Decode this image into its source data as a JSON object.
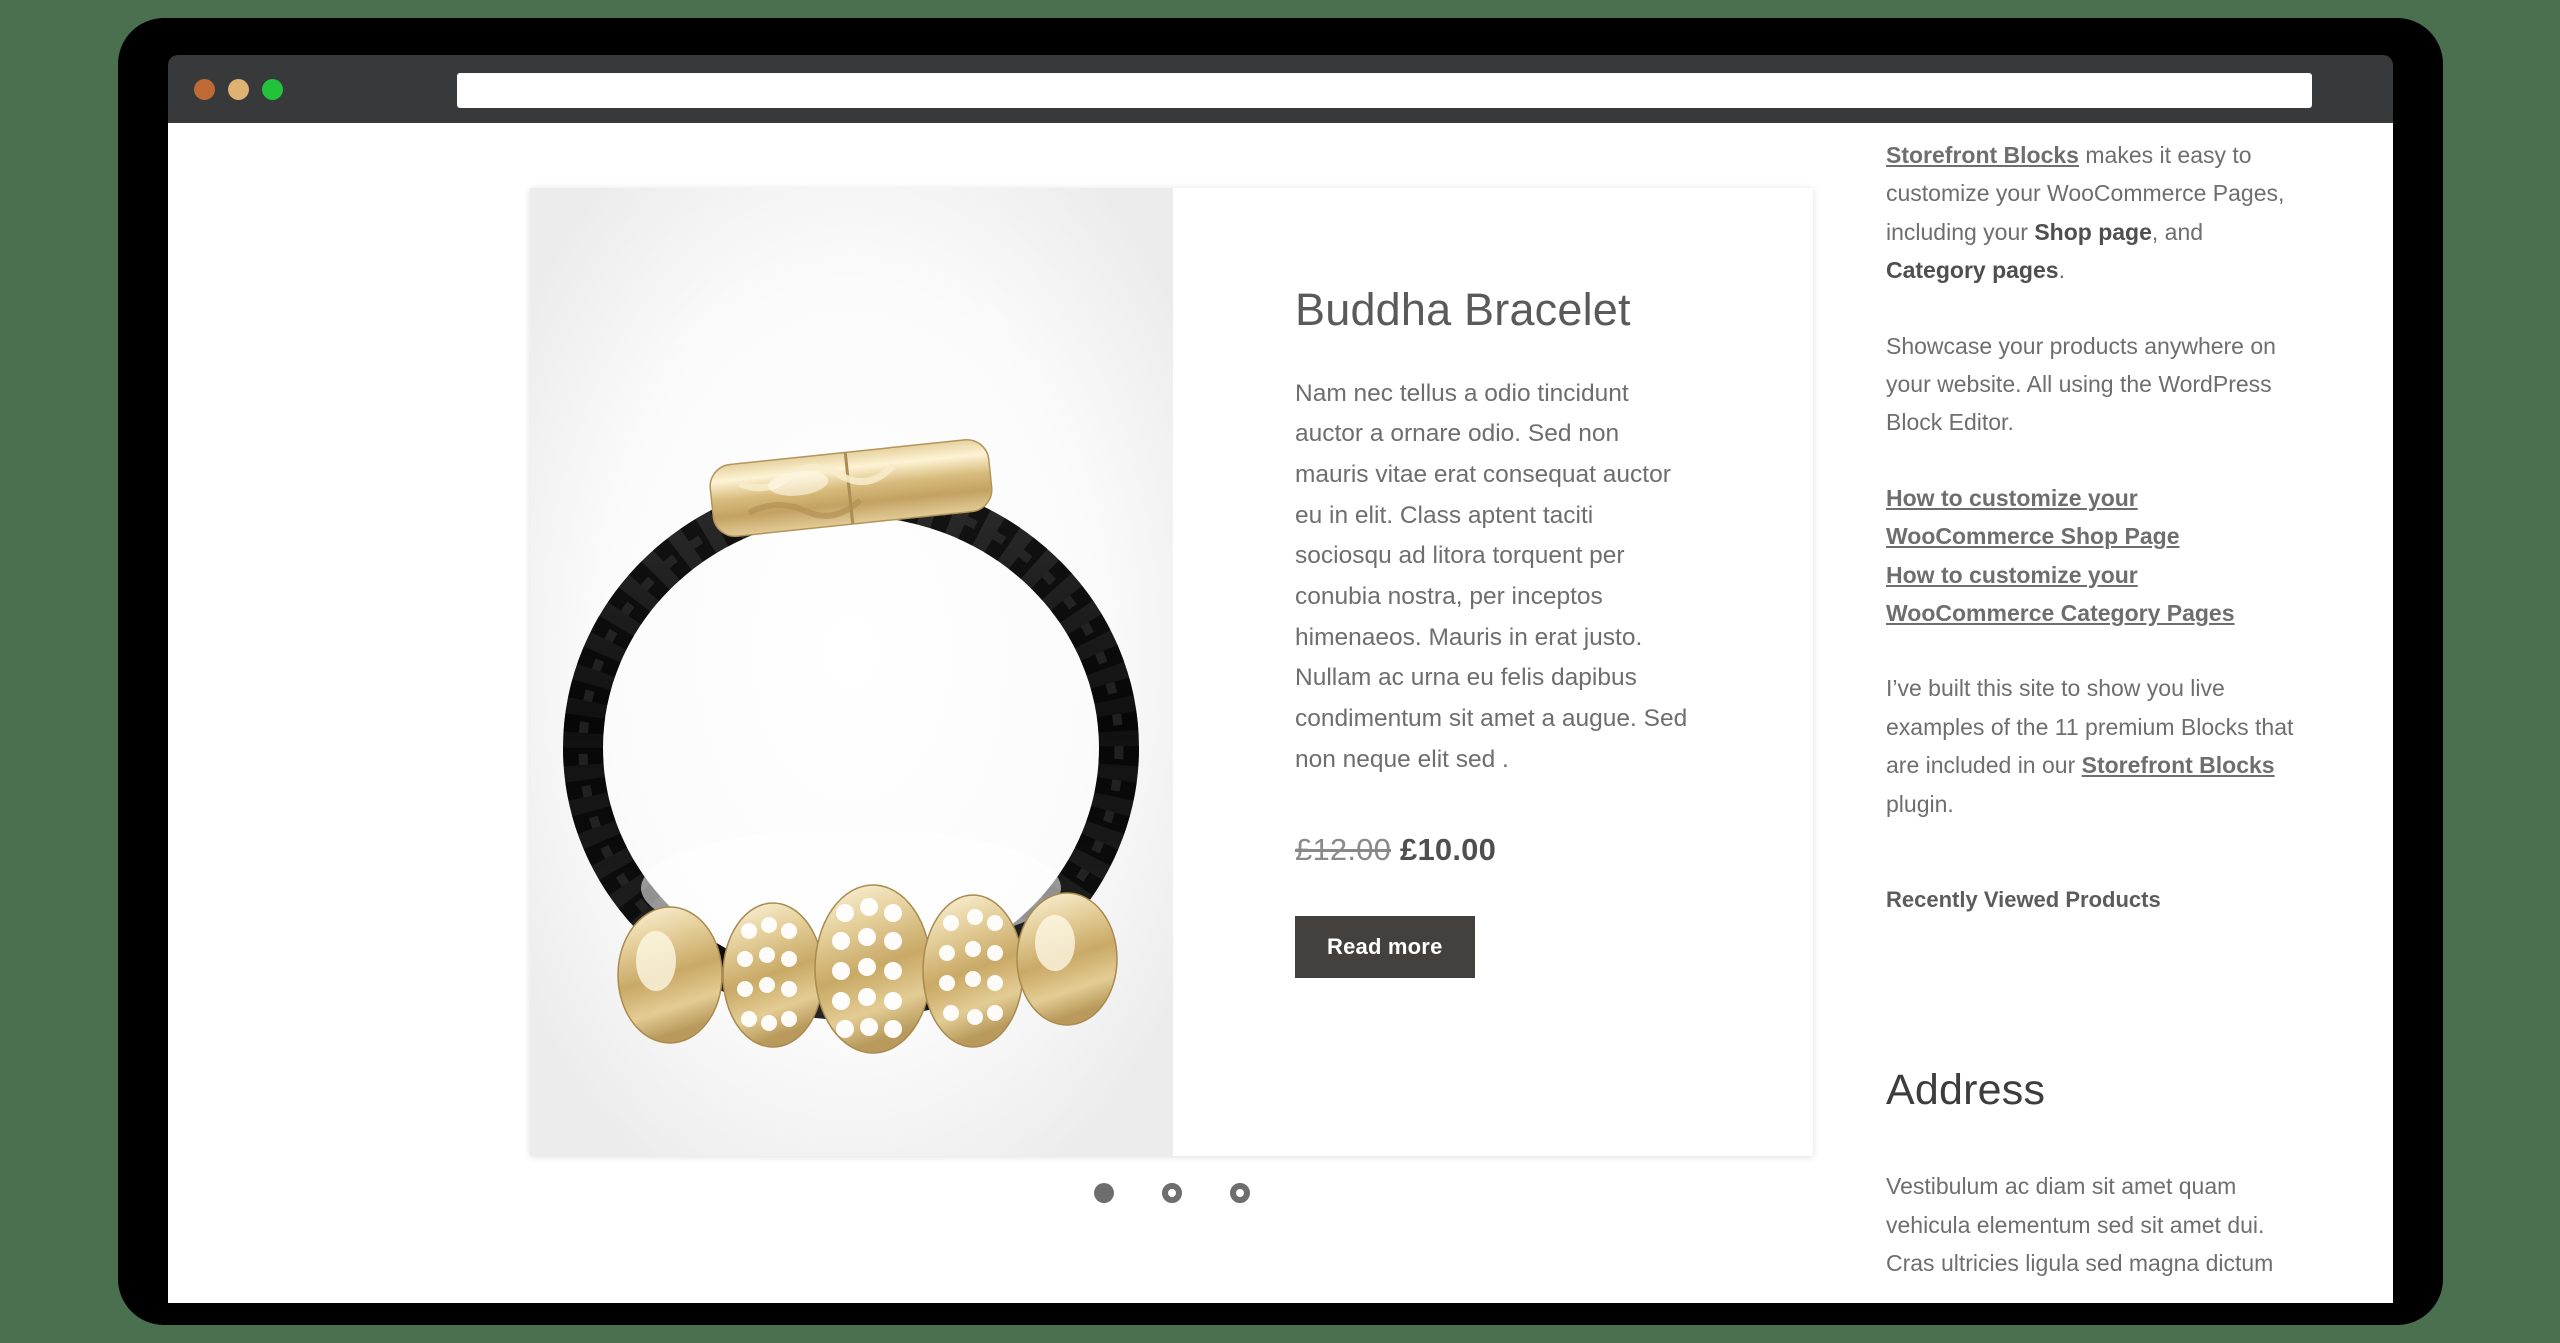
{
  "browser": {
    "url_value": "",
    "url_placeholder": "",
    "traffic_lights": [
      {
        "name": "close",
        "color": "#bf6a34"
      },
      {
        "name": "minimize",
        "color": "#deb272"
      },
      {
        "name": "zoom",
        "color": "#22c33a"
      }
    ]
  },
  "product": {
    "title": "Buddha Bracelet",
    "description": "Nam nec tellus a odio tincidunt auctor a ornare odio. Sed non mauris vitae erat consequat auctor eu in elit. Class aptent taciti sociosqu ad litora torquent per conubia nostra, per inceptos himenaeos. Mauris in erat justo. Nullam ac urna eu felis dapibus condimentum sit amet a augue. Sed non neque elit sed .",
    "price_old": "£12.00",
    "price_current": "£10.00",
    "button_label": "Read more",
    "image_alt": "Black braided leather bracelet with gold clasp and crystal rondelle beads"
  },
  "carousel": {
    "dots": [
      {
        "state": "active"
      },
      {
        "state": "inactive"
      },
      {
        "state": "inactive"
      }
    ]
  },
  "sidebar": {
    "intro": {
      "link_text": "Storefront Blocks",
      "text_1": " makes it easy to customize your WooCommerce Pages, including your ",
      "bold_1": "Shop page",
      "text_2": ", and ",
      "bold_2": "Category pages",
      "text_3": "."
    },
    "showcase_paragraph": "Showcase your products anywhere on your website. All using the WordPress Block Editor.",
    "links": [
      "How to customize your WooCommerce Shop Page",
      "How to customize your WooCommerce Category Pages"
    ],
    "built_paragraph": {
      "text_1": "I’ve built this site to show you live examples of the 11 premium Blocks that are included in our ",
      "link_text": "Storefront Blocks",
      "text_2": " plugin."
    },
    "recently_viewed_heading": "Recently Viewed Products",
    "address_heading": "Address",
    "address_body": "Vestibulum ac diam sit amet quam vehicula elementum sed sit amet dui. Cras ultricies ligula sed magna dictum"
  },
  "colors": {
    "page_background": "#4a7050",
    "chrome": "#37393b",
    "button": "#43403d",
    "text_muted": "#6e6e6e",
    "image_pane": "#f2f2f2"
  }
}
